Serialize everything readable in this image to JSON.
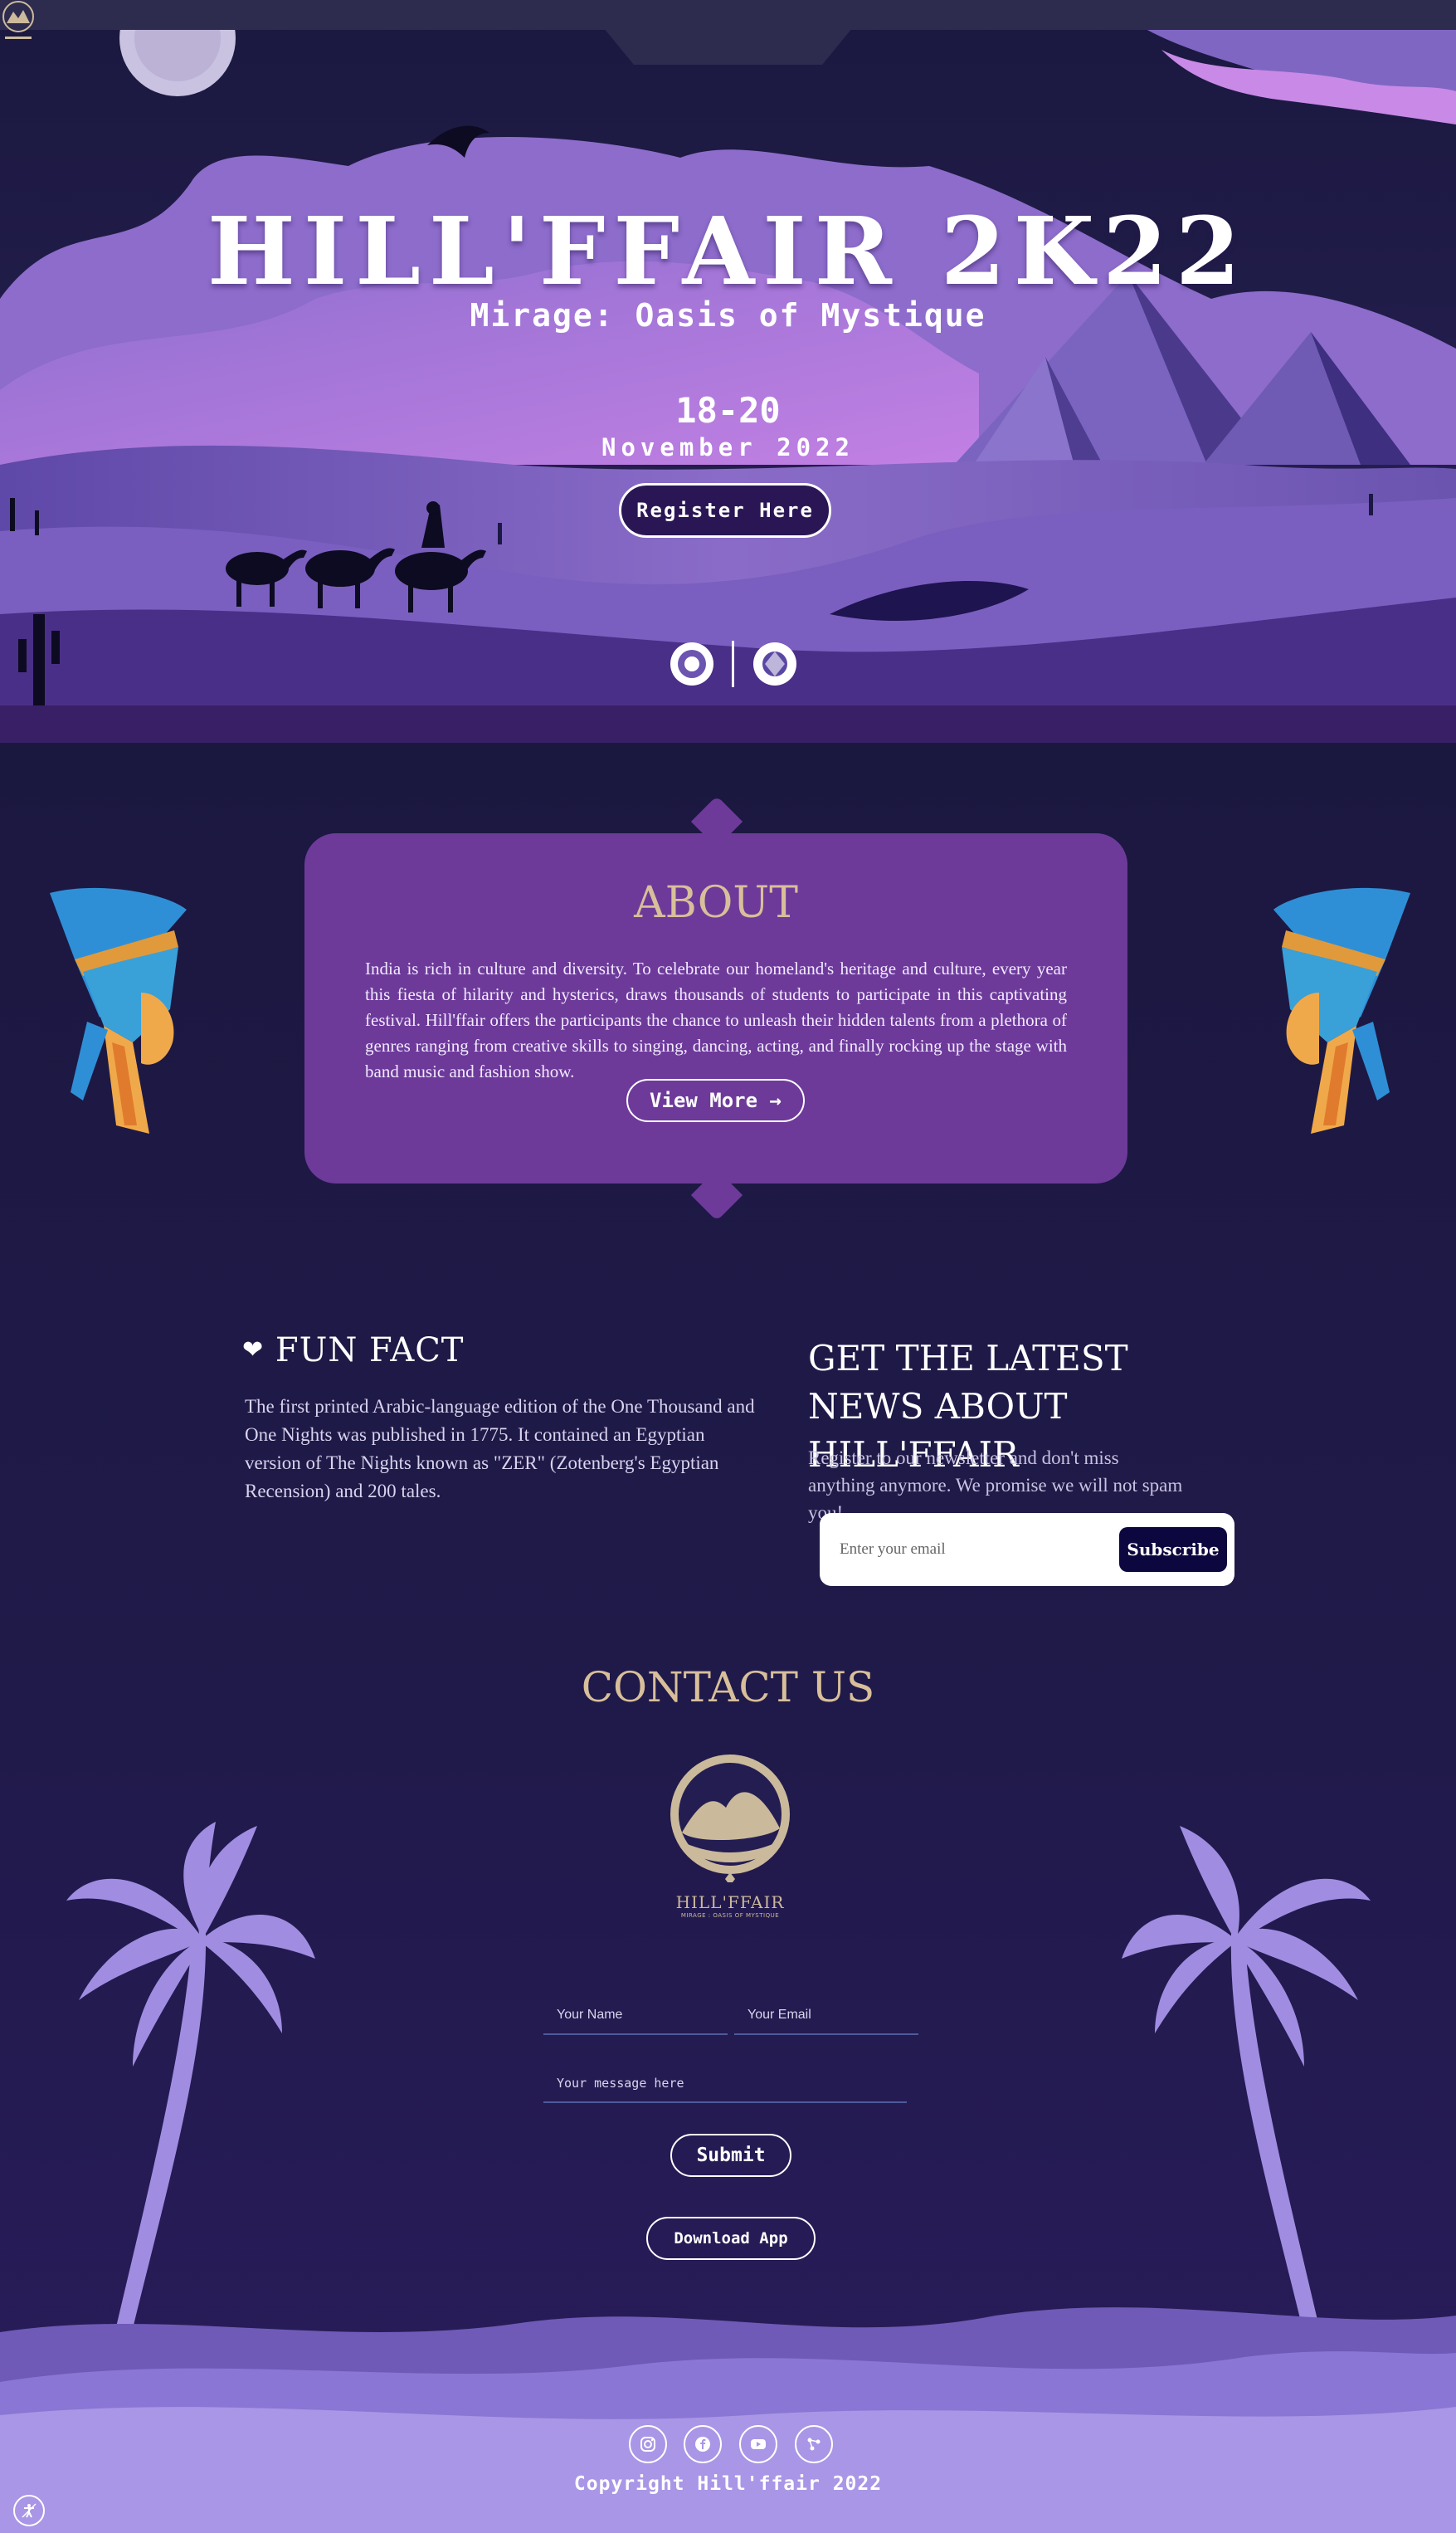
{
  "hero": {
    "title": "HILL'FFAIR 2K22",
    "subtitle": "Mirage: Oasis of Mystique",
    "dates": "18-20",
    "month": "November 2022",
    "register_label": "Register Here"
  },
  "nav": {
    "logo_icon": "hillffair-logo-icon"
  },
  "about": {
    "title": "ABOUT",
    "text": "India is rich in culture and diversity. To celebrate our homeland's heritage and culture, every year this fiesta of hilarity and hysterics, draws thousands of students to participate in this captivating festival. Hill'ffair offers the participants the chance to unleash their hidden talents from a plethora of genres ranging from creative skills to singing, dancing, acting, and finally rocking up the stage with band music and fashion show.",
    "button_label": "View More"
  },
  "fun_fact": {
    "title": "FUN FACT",
    "text": "The first printed Arabic-language edition of the One Thousand and One Nights was published in 1775. It contained an Egyptian version of The Nights known as \"ZER\" (Zotenberg's Egyptian Recension) and 200 tales."
  },
  "newsletter": {
    "title": "GET THE LATEST NEWS ABOUT HILL'FFAIR",
    "text": "Register to our newsletter and don't miss anything anymore. We promise we will not spam you!",
    "email_placeholder": "Enter your email",
    "subscribe_label": "Subscribe"
  },
  "contact": {
    "title": "CONTACT US",
    "logo_name": "HILL'FFAIR",
    "logo_tagline": "MIRAGE : OASIS OF MYSTIQUE",
    "name_placeholder": "Your Name",
    "email_placeholder": "Your Email",
    "message_placeholder": "Your message here",
    "submit_label": "Submit",
    "download_label": "Download App"
  },
  "footer": {
    "social_icons": [
      "instagram-icon",
      "facebook-icon",
      "youtube-icon",
      "link-icon"
    ],
    "copyright": "Copyright Hill'ffair 2022"
  },
  "colors": {
    "page_bg": "#1b1840",
    "about_card": "#6d3a9a",
    "accent_gold": "#d8bf9a",
    "footer_lavender": "#a996e6",
    "subscribe_bg": "#0d0740"
  }
}
